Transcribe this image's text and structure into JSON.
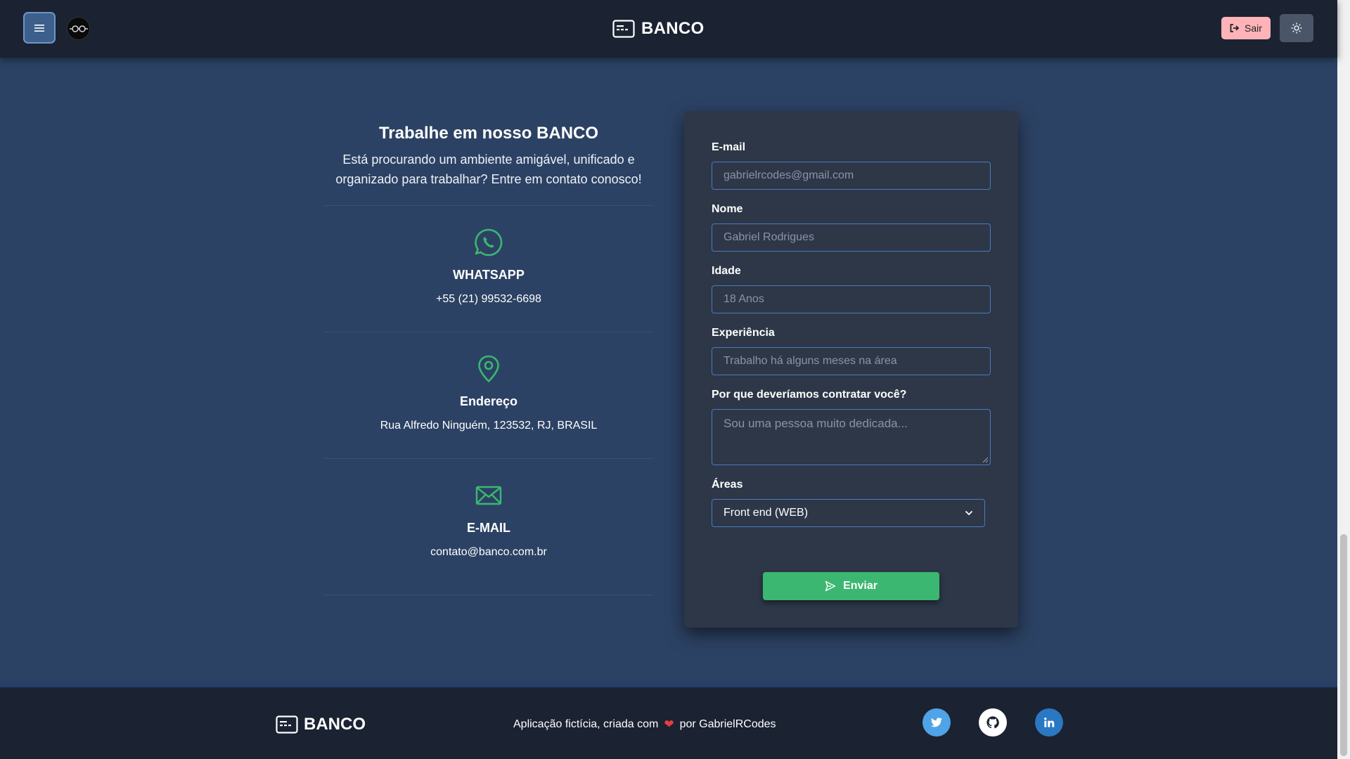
{
  "header": {
    "menu_icon": "hamburger-icon",
    "avatar_icon": "glasses-avatar-icon",
    "brand_icon": "card-icon",
    "brand": "BANCO",
    "logout_label": "Sair",
    "logout_icon": "sign-out-icon",
    "theme_icon": "sun-icon",
    "logout_color": "#fdb3b7"
  },
  "info": {
    "title": "Trabalhe em nosso BANCO",
    "description": "Está procurando um ambiente amigável, unificado e organizado para trabalhar? Entre em contato conosco!",
    "blocks": [
      {
        "icon": "whatsapp-icon",
        "heading": "WHATSAPP",
        "text": "+55 (21) 99532-6698"
      },
      {
        "icon": "location-pin-icon",
        "heading": "Endereço",
        "text": "Rua Alfredo Ninguém, 123532, RJ, BRASIL"
      },
      {
        "icon": "envelope-icon",
        "heading": "E-MAIL",
        "text": "contato@banco.com.br"
      }
    ],
    "accent_color": "#3bb771"
  },
  "form": {
    "email": {
      "label": "E-mail",
      "placeholder": "gabrielrcodes@gmail.com"
    },
    "name": {
      "label": "Nome",
      "placeholder": "Gabriel Rodrigues"
    },
    "age": {
      "label": "Idade",
      "placeholder": "18 Anos"
    },
    "experience": {
      "label": "Experiência",
      "placeholder": "Trabalho há alguns meses na área"
    },
    "reason": {
      "label": "Por que deveríamos contratar você?",
      "placeholder": "Sou uma pessoa muito dedicada..."
    },
    "areas": {
      "label": "Áreas",
      "selected": "Front end (WEB)"
    },
    "submit_label": "Enviar",
    "submit_icon": "send-icon",
    "submit_color": "#3bb771"
  },
  "footer": {
    "brand": "BANCO",
    "credit_prefix": "Aplicação fictícia, criada com",
    "credit_heart": "❤",
    "credit_suffix": "por GabrielRCodes",
    "socials": [
      {
        "icon": "twitter-icon",
        "color": "#4fa3e6"
      },
      {
        "icon": "github-icon",
        "color": "#ffffff"
      },
      {
        "icon": "linkedin-icon",
        "color": "#2a78c2"
      }
    ]
  }
}
